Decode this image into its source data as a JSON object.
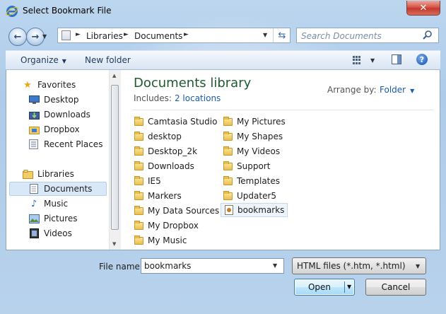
{
  "window": {
    "title": "Select Bookmark File"
  },
  "nav": {
    "back_label": "←",
    "forward_label": "→",
    "breadcrumb": [
      "Libraries",
      "Documents"
    ],
    "search_placeholder": "Search Documents"
  },
  "toolbar": {
    "organize": "Organize",
    "new_folder": "New folder"
  },
  "sidebar": {
    "favorites_header": "Favorites",
    "favorites": [
      "Desktop",
      "Downloads",
      "Dropbox",
      "Recent Places"
    ],
    "libraries_header": "Libraries",
    "libraries": [
      "Documents",
      "Music",
      "Pictures",
      "Videos"
    ],
    "selected": "Documents"
  },
  "library": {
    "title": "Documents library",
    "includes_label": "Includes:",
    "includes_link": "2 locations",
    "arrange_label": "Arrange by:",
    "arrange_value": "Folder"
  },
  "files": {
    "column1": [
      "Camtasia Studio",
      "desktop",
      "Desktop_2k",
      "Downloads",
      "IE5",
      "Markers",
      "My Data Sources",
      "My Dropbox",
      "My Music"
    ],
    "column2": [
      "My Pictures",
      "My Shapes",
      "My Videos",
      "Support",
      "Templates",
      "Updater5",
      "bookmarks"
    ],
    "selected": "bookmarks"
  },
  "footer": {
    "filename_label": "File name:",
    "filename_value": "bookmarks",
    "filetype_value": "HTML files (*.htm, *.html)",
    "open_label": "Open",
    "cancel_label": "Cancel"
  },
  "colors": {
    "library_title": "#1e5a2f",
    "link": "#1a5cad",
    "selection": "#d9e8f8"
  }
}
